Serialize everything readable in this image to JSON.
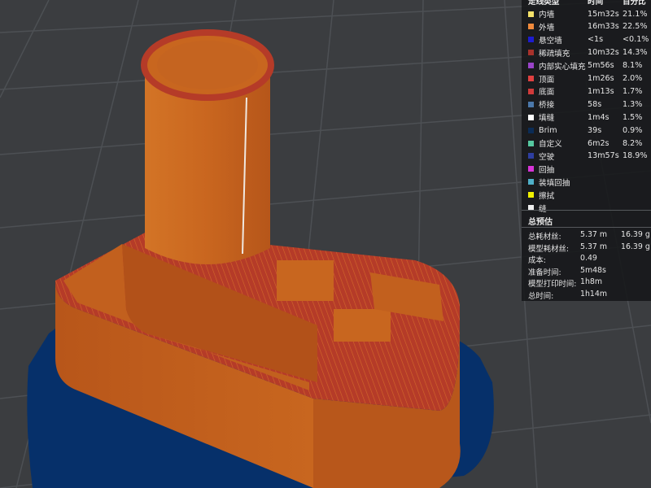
{
  "legend": {
    "headers": {
      "type": "走线类型",
      "time": "时间",
      "percent": "百分比"
    },
    "rows": [
      {
        "name": "内墙",
        "time": "15m32s",
        "percent": "21.1%",
        "color": "#f5e26a"
      },
      {
        "name": "外墙",
        "time": "16m33s",
        "percent": "22.5%",
        "color": "#f08a3c"
      },
      {
        "name": "悬空墙",
        "time": "<1s",
        "percent": "<0.1%",
        "color": "#1d1cd0"
      },
      {
        "name": "稀疏填充",
        "time": "10m32s",
        "percent": "14.3%",
        "color": "#a8322b"
      },
      {
        "name": "内部实心填充",
        "time": "5m56s",
        "percent": "8.1%",
        "color": "#9a44c8"
      },
      {
        "name": "顶面",
        "time": "1m26s",
        "percent": "2.0%",
        "color": "#e04040"
      },
      {
        "name": "底面",
        "time": "1m13s",
        "percent": "1.7%",
        "color": "#d03a3a"
      },
      {
        "name": "桥接",
        "time": "58s",
        "percent": "1.3%",
        "color": "#4b78aa"
      },
      {
        "name": "填缝",
        "time": "1m4s",
        "percent": "1.5%",
        "color": "#ffffff"
      },
      {
        "name": "Brim",
        "time": "39s",
        "percent": "0.9%",
        "color": "#0b2c56"
      },
      {
        "name": "自定义",
        "time": "6m2s",
        "percent": "8.2%",
        "color": "#56c8a0"
      },
      {
        "name": "空驶",
        "time": "13m57s",
        "percent": "18.9%",
        "color": "#2e3ea0"
      },
      {
        "name": "回抽",
        "time": "",
        "percent": "",
        "color": "#d834d8"
      },
      {
        "name": "装填回抽",
        "time": "",
        "percent": "",
        "color": "#4fb0c8"
      },
      {
        "name": "擦拭",
        "time": "",
        "percent": "",
        "color": "#f0f000"
      },
      {
        "name": "缝",
        "time": "",
        "percent": "",
        "color": "#eeeeee"
      }
    ]
  },
  "estimate": {
    "title": "总预估",
    "rows": [
      {
        "label": "总耗材丝:",
        "v1": "5.37 m",
        "v2": "16.39 g"
      },
      {
        "label": "模型耗材丝:",
        "v1": "5.37 m",
        "v2": "16.39 g"
      },
      {
        "label": "成本:",
        "v1": "0.49",
        "v2": ""
      },
      {
        "label": "准备时间:",
        "v1": "5m48s",
        "v2": ""
      },
      {
        "label": "模型打印时间:",
        "v1": "1h8m",
        "v2": ""
      },
      {
        "label": "总时间:",
        "v1": "1h14m",
        "v2": ""
      }
    ]
  },
  "scene": {
    "model_color": "#c8621e",
    "brim_color": "#06306a",
    "plate_color": "#3b3d40"
  }
}
